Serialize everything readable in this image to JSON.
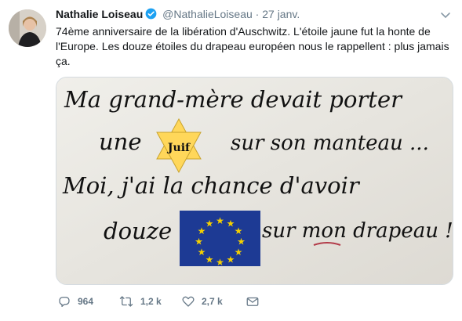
{
  "author": {
    "name": "Nathalie Loiseau",
    "handle": "@NathalieLoiseau",
    "separator": "·",
    "date": "27 janv."
  },
  "tweet": {
    "text": "74ème anniversaire de la libération d'Auschwitz. L'étoile jaune fut la honte de l'Europe. Les douze étoiles du drapeau européen nous le rappellent : plus jamais ça."
  },
  "image": {
    "line1": "Ma grand-mère devait porter",
    "line2a": "une",
    "star_word": "Juif",
    "line2b": "sur son manteau ...",
    "line3": "Moi, j'ai la chance d'avoir",
    "line4a": "douze",
    "line4b": "sur mon drapeau !"
  },
  "actions": {
    "replies": "964",
    "retweets": "1,2 k",
    "likes": "2,7 k"
  },
  "icons": {
    "verified": "verified-badge-icon",
    "more": "chevron-down-icon",
    "reply": "reply-icon",
    "retweet": "retweet-icon",
    "like": "heart-icon",
    "message": "envelope-icon"
  },
  "colors": {
    "verified_blue": "#1da1f2",
    "icon_gray": "#657786",
    "flag_blue": "#1d3a94",
    "flag_star": "#f5d000",
    "yellow_star": "#ffd75a"
  }
}
